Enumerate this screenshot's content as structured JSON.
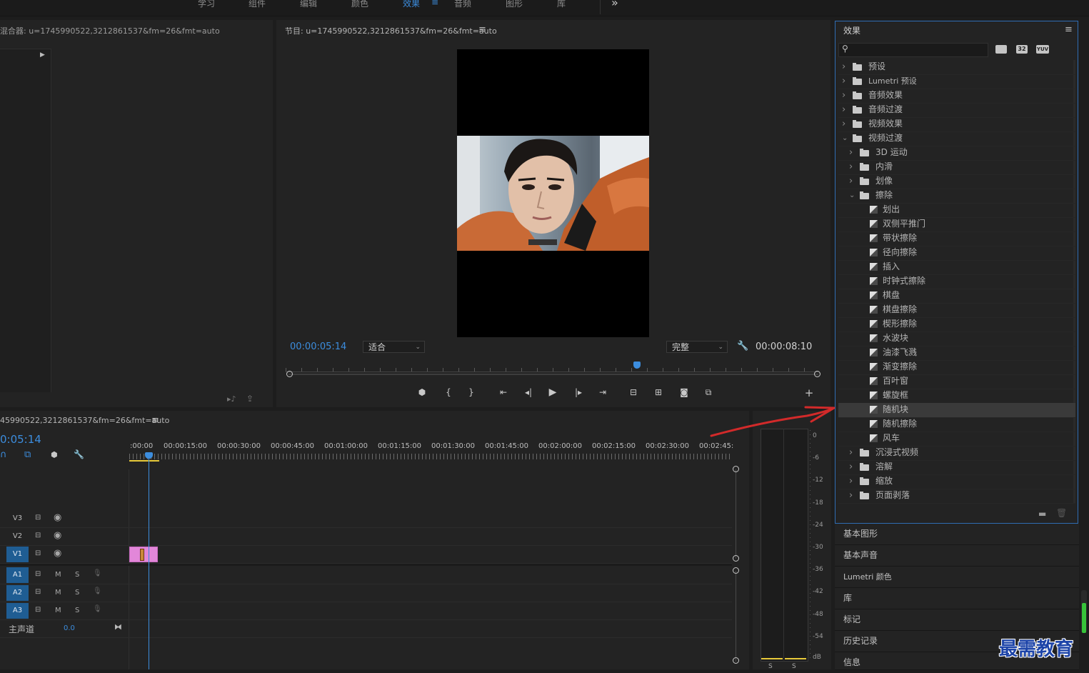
{
  "workspace_tabs": [
    {
      "label": "学习",
      "active": false
    },
    {
      "label": "组件",
      "active": false
    },
    {
      "label": "编辑",
      "active": false
    },
    {
      "label": "颜色",
      "active": false
    },
    {
      "label": "效果",
      "active": true
    },
    {
      "label": "音频",
      "active": false
    },
    {
      "label": "图形",
      "active": false
    },
    {
      "label": "库",
      "active": false
    }
  ],
  "more_label": "»",
  "source_panel": {
    "title": "混合器: u=1745990522,3212861537&fm=26&fmt=auto"
  },
  "program_monitor": {
    "title": "节目: u=1745990522,3212861537&fm=26&fmt=auto",
    "current_time": "00:00:05:14",
    "fit_label": "适合",
    "quality_label": "完整",
    "duration": "00:00:08:10",
    "playhead_fraction": 0.66
  },
  "timeline": {
    "title": "45990522,3212861537&fm=26&fmt=auto",
    "current_time": "0:05:14",
    "ruler": [
      ":00:00",
      "00:00:15:00",
      "00:00:30:00",
      "00:00:45:00",
      "00:01:00:00",
      "00:01:15:00",
      "00:01:30:00",
      "00:01:45:00",
      "00:02:00:00",
      "00:02:15:00",
      "00:02:30:00",
      "00:02:45:"
    ],
    "video_tracks": [
      {
        "name": "V3",
        "selected": false
      },
      {
        "name": "V2",
        "selected": false
      },
      {
        "name": "V1",
        "selected": true
      }
    ],
    "audio_tracks": [
      {
        "name": "A1",
        "m": "M",
        "s": "S"
      },
      {
        "name": "A2",
        "m": "M",
        "s": "S"
      },
      {
        "name": "A3",
        "m": "M",
        "s": "S"
      }
    ],
    "master": {
      "label": "主声道",
      "value": "0.0"
    }
  },
  "meters": {
    "scale": [
      "0",
      "-6",
      "-12",
      "-18",
      "-24",
      "-30",
      "-36",
      "-42",
      "-48",
      "-54",
      "dB"
    ],
    "bottom_labels": [
      "S",
      "S"
    ]
  },
  "effects_panel": {
    "title": "效果",
    "search_placeholder": "",
    "toolbar_badges": [
      "32",
      "YUV"
    ],
    "tree": [
      {
        "label": "预设",
        "level": 0,
        "type": "preset-folder",
        "expanded": false
      },
      {
        "label": "Lumetri 预设",
        "level": 0,
        "type": "preset-folder",
        "expanded": false
      },
      {
        "label": "音频效果",
        "level": 0,
        "type": "folder",
        "expanded": false
      },
      {
        "label": "音频过渡",
        "level": 0,
        "type": "folder",
        "expanded": false
      },
      {
        "label": "视频效果",
        "level": 0,
        "type": "folder",
        "expanded": false
      },
      {
        "label": "视频过渡",
        "level": 0,
        "type": "folder",
        "expanded": true
      },
      {
        "label": "3D 运动",
        "level": 1,
        "type": "folder",
        "expanded": false
      },
      {
        "label": "内滑",
        "level": 1,
        "type": "folder",
        "expanded": false
      },
      {
        "label": "划像",
        "level": 1,
        "type": "folder",
        "expanded": false
      },
      {
        "label": "擦除",
        "level": 1,
        "type": "folder",
        "expanded": true
      },
      {
        "label": "划出",
        "level": 2,
        "type": "effect"
      },
      {
        "label": "双侧平推门",
        "level": 2,
        "type": "effect"
      },
      {
        "label": "带状擦除",
        "level": 2,
        "type": "effect"
      },
      {
        "label": "径向擦除",
        "level": 2,
        "type": "effect"
      },
      {
        "label": "插入",
        "level": 2,
        "type": "effect"
      },
      {
        "label": "时钟式擦除",
        "level": 2,
        "type": "effect"
      },
      {
        "label": "棋盘",
        "level": 2,
        "type": "effect"
      },
      {
        "label": "棋盘擦除",
        "level": 2,
        "type": "effect"
      },
      {
        "label": "楔形擦除",
        "level": 2,
        "type": "effect"
      },
      {
        "label": "水波块",
        "level": 2,
        "type": "effect"
      },
      {
        "label": "油漆飞溅",
        "level": 2,
        "type": "effect"
      },
      {
        "label": "渐变擦除",
        "level": 2,
        "type": "effect"
      },
      {
        "label": "百叶窗",
        "level": 2,
        "type": "effect"
      },
      {
        "label": "螺旋框",
        "level": 2,
        "type": "effect"
      },
      {
        "label": "随机块",
        "level": 2,
        "type": "effect",
        "highlighted": true
      },
      {
        "label": "随机擦除",
        "level": 2,
        "type": "effect"
      },
      {
        "label": "风车",
        "level": 2,
        "type": "effect"
      },
      {
        "label": "沉浸式视频",
        "level": 1,
        "type": "folder",
        "expanded": false
      },
      {
        "label": "溶解",
        "level": 1,
        "type": "folder",
        "expanded": false
      },
      {
        "label": "缩放",
        "level": 1,
        "type": "folder",
        "expanded": false
      },
      {
        "label": "页面剥落",
        "level": 1,
        "type": "folder",
        "expanded": false
      }
    ]
  },
  "side_panels": [
    "基本图形",
    "基本声音",
    "Lumetri 颜色",
    "库",
    "标记",
    "历史记录",
    "信息"
  ],
  "watermark": "最需教育",
  "colors": {
    "accent": "#3c8dde",
    "clip": "#e287d9",
    "annotation": "#d22a2a",
    "panel_border": "#2f6db3"
  }
}
